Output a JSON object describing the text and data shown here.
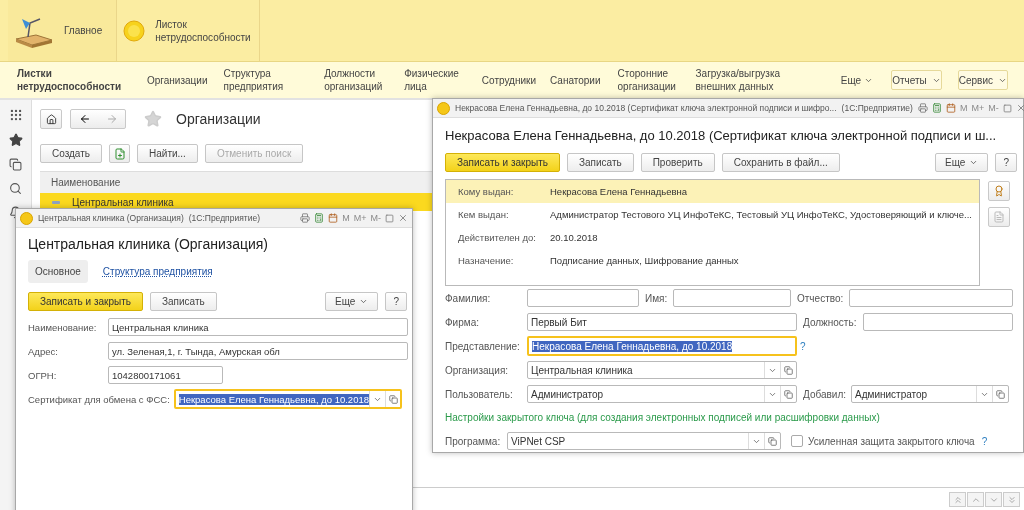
{
  "sections": [
    {
      "label": "Главное",
      "kind": "desk"
    },
    {
      "label": "Листок нетрудоспособности",
      "kind": "sun"
    }
  ],
  "nav": {
    "items": [
      {
        "label": "Листки нетрудоспособности",
        "selected": true
      },
      {
        "label": "Организации",
        "selected": false
      },
      {
        "label": "Структура предприятия",
        "selected": false
      },
      {
        "label": "Должности организаций",
        "selected": false
      },
      {
        "label": "Физические лица",
        "selected": false
      },
      {
        "label": "Сотрудники",
        "selected": false
      },
      {
        "label": "Санатории",
        "selected": false
      },
      {
        "label": "Сторонние организации",
        "selected": false
      },
      {
        "label": "Загрузка/выгрузка внешних данных",
        "selected": false
      }
    ],
    "more": "Еще",
    "menus": [
      "Отчеты",
      "Сервис"
    ]
  },
  "list": {
    "title": "Организации",
    "buttons": [
      {
        "label": "Создать",
        "disabled": false
      },
      {
        "label": "Найти...",
        "disabled": false
      },
      {
        "label": "Отменить поиск",
        "disabled": true
      }
    ],
    "columns": [
      "Наименование"
    ],
    "rows": [
      {
        "name": "Центральная клиника",
        "selected": true
      }
    ]
  },
  "org_window": {
    "caption": "Центральная клиника (Организация)",
    "app": "(1С:Предприятие)",
    "memory_keys": [
      "M",
      "M+",
      "M-"
    ],
    "title": "Центральная клиника (Организация)",
    "tabs": [
      {
        "label": "Основное",
        "selected": true
      },
      {
        "label": "Структура предприятия",
        "selected": false
      }
    ],
    "buttons": [
      {
        "label": "Записать и закрыть",
        "kind": "primary"
      },
      {
        "label": "Записать",
        "kind": "default"
      }
    ],
    "more": "Еще",
    "help": "?",
    "fields": [
      {
        "label": "Наименование:",
        "value": "Центральная клиника",
        "kind": "text",
        "focused": false
      },
      {
        "label": "Адрес:",
        "value": "ул. Зеленая,1, г. Тында, Амурская обл",
        "kind": "text",
        "focused": false
      },
      {
        "label": "ОГРН:",
        "value": "1042800171061",
        "kind": "text",
        "focused": false
      },
      {
        "label": "Сертификат для обмена с ФСС:",
        "value": "Некрасова Елена Геннадьевна, до 10.2018",
        "kind": "select",
        "focused": true
      }
    ]
  },
  "cert_window": {
    "caption": "Некрасова Елена Геннадьевна, до 10.2018 (Сертификат ключа электронной подписи и шифро...",
    "app": "(1С:Предприятие)",
    "memory_keys": [
      "M",
      "M+",
      "M-"
    ],
    "title": "Некрасова Елена Геннадьевна, до 10.2018 (Сертификат ключа электронной подписи и ш...",
    "buttons": [
      {
        "label": "Записать и закрыть",
        "kind": "primary"
      },
      {
        "label": "Записать",
        "kind": "default"
      },
      {
        "label": "Проверить",
        "kind": "default"
      },
      {
        "label": "Сохранить в файл...",
        "kind": "default"
      }
    ],
    "more": "Еще",
    "help": "?",
    "details": [
      {
        "label": "Кому выдан:",
        "value": "Некрасова Елена Геннадьевна",
        "selected": true
      },
      {
        "label": "Кем выдан:",
        "value": "Администратор Тестового УЦ ИнфоТеКС, Тестовый УЦ ИнфоТеКС, Удостоверяющий и ключе...",
        "selected": false
      },
      {
        "label": "Действителен до:",
        "value": "20.10.2018",
        "selected": false
      },
      {
        "label": "Назначение:",
        "value": "Подписание данных, Шифрование данных",
        "selected": false
      }
    ],
    "form": [
      [
        {
          "label": "Фамилия:",
          "kind": "text",
          "focused": false
        },
        {
          "label": "Имя:",
          "kind": "text",
          "focused": false
        },
        {
          "label": "Отчество:",
          "kind": "text",
          "focused": false
        }
      ],
      [
        {
          "label": "Фирма:",
          "value": "Первый Бит",
          "kind": "text",
          "focused": false
        },
        {
          "label": "Должность:",
          "kind": "text",
          "focused": false
        }
      ],
      [
        {
          "label": "Представление:",
          "value": "Некрасова Елена Геннадьевна, до 10.2018",
          "kind": "text",
          "focused": true,
          "hint": "?"
        }
      ],
      [
        {
          "label": "Организация:",
          "value": "Центральная клиника",
          "kind": "select",
          "focused": false
        }
      ],
      [
        {
          "label": "Пользователь:",
          "value": "Администратор",
          "kind": "select",
          "focused": false
        },
        {
          "label": "Добавил:",
          "value": "Администратор",
          "kind": "select",
          "focused": false
        }
      ],
      [
        {
          "label": "Настройки закрытого ключа (для создания электронных подписей или расшифровки данных)",
          "kind": "heading"
        }
      ],
      [
        {
          "label": "Программа:",
          "value": "ViPNet CSP",
          "kind": "select",
          "focused": false
        },
        {
          "label": "Усиленная защита закрытого ключа",
          "kind": "checkbox",
          "checked": false,
          "hint": "?"
        }
      ]
    ]
  }
}
